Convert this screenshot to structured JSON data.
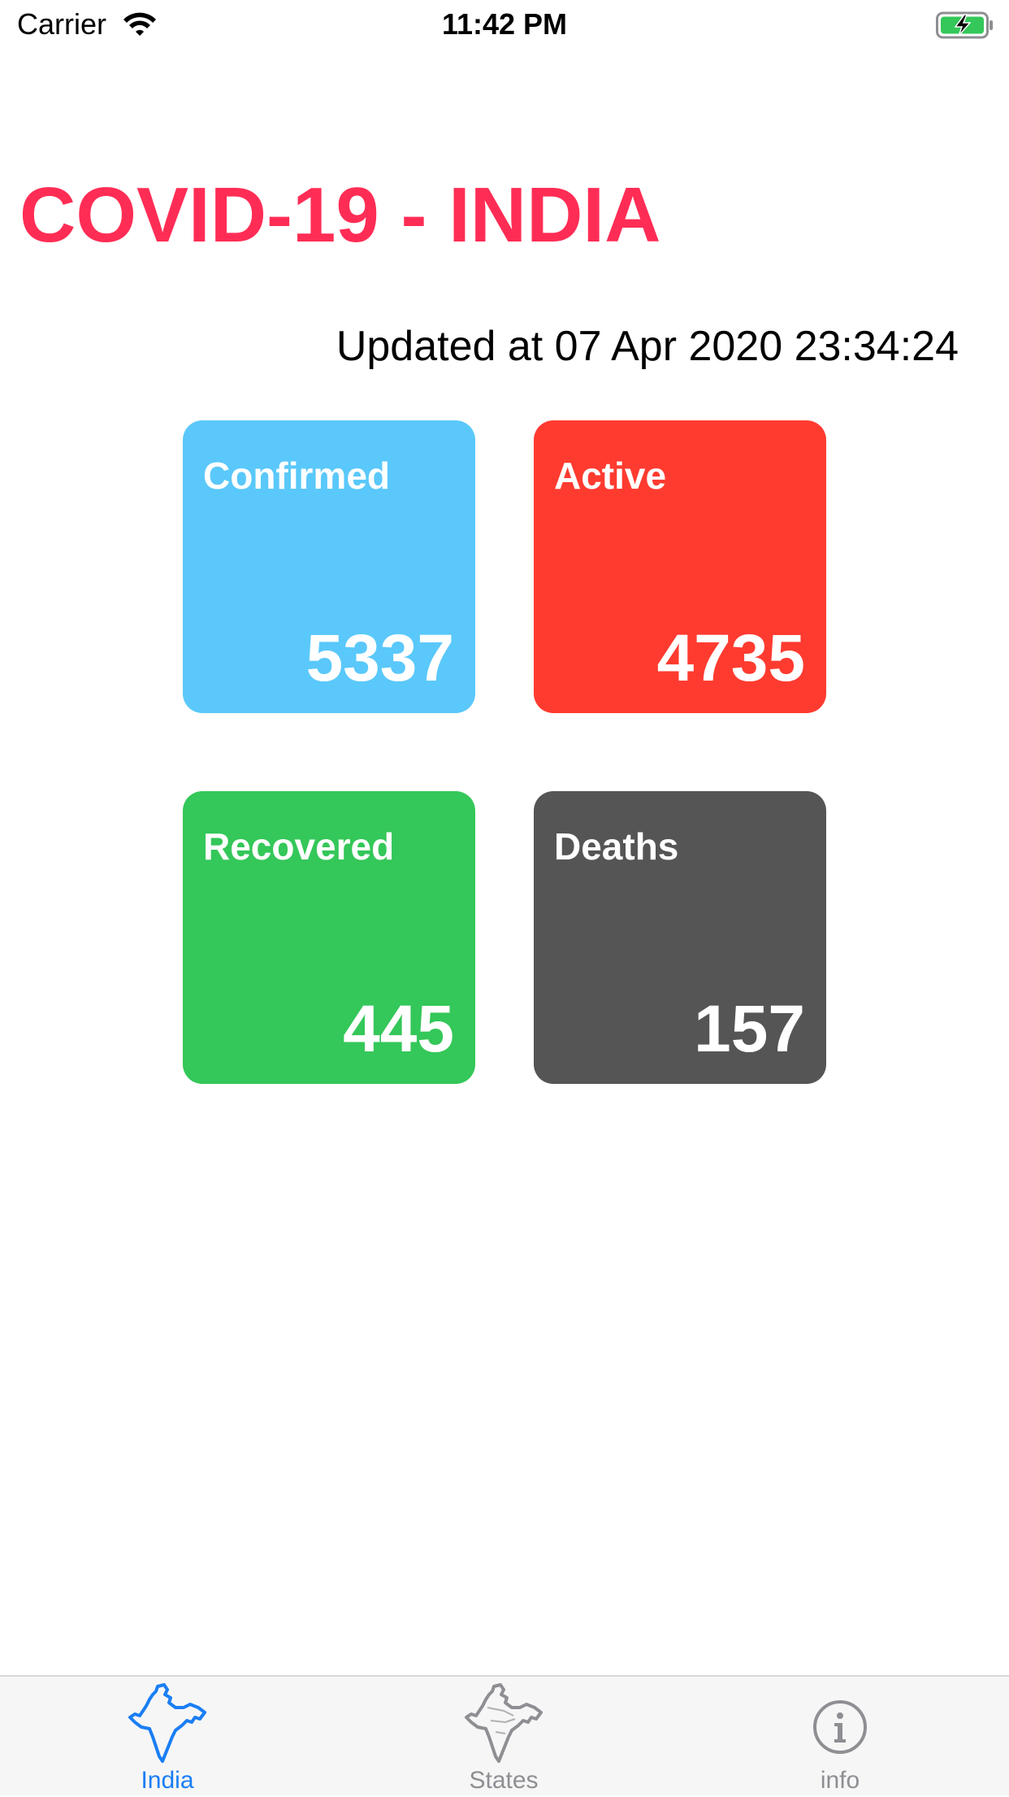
{
  "status_bar": {
    "carrier": "Carrier",
    "time": "11:42 PM"
  },
  "title": "COVID-19 - INDIA",
  "updated": "Updated at 07 Apr 2020 23:34:24",
  "cards": {
    "confirmed": {
      "label": "Confirmed",
      "value": "5337",
      "color": "#5ac8fa"
    },
    "active": {
      "label": "Active",
      "value": "4735",
      "color": "#ff3b30"
    },
    "recovered": {
      "label": "Recovered",
      "value": "445",
      "color": "#34c759"
    },
    "deaths": {
      "label": "Deaths",
      "value": "157",
      "color": "#555555"
    }
  },
  "tabs": [
    {
      "label": "India",
      "icon": "india-map-icon",
      "selected": true,
      "color": "#1a7ef5"
    },
    {
      "label": "States",
      "icon": "states-map-icon",
      "selected": false,
      "color": "#8e8e93"
    },
    {
      "label": "info",
      "icon": "info-icon",
      "selected": false,
      "color": "#8e8e93"
    }
  ],
  "colors": {
    "title": "#ff2d55",
    "battery": "#34c759"
  }
}
